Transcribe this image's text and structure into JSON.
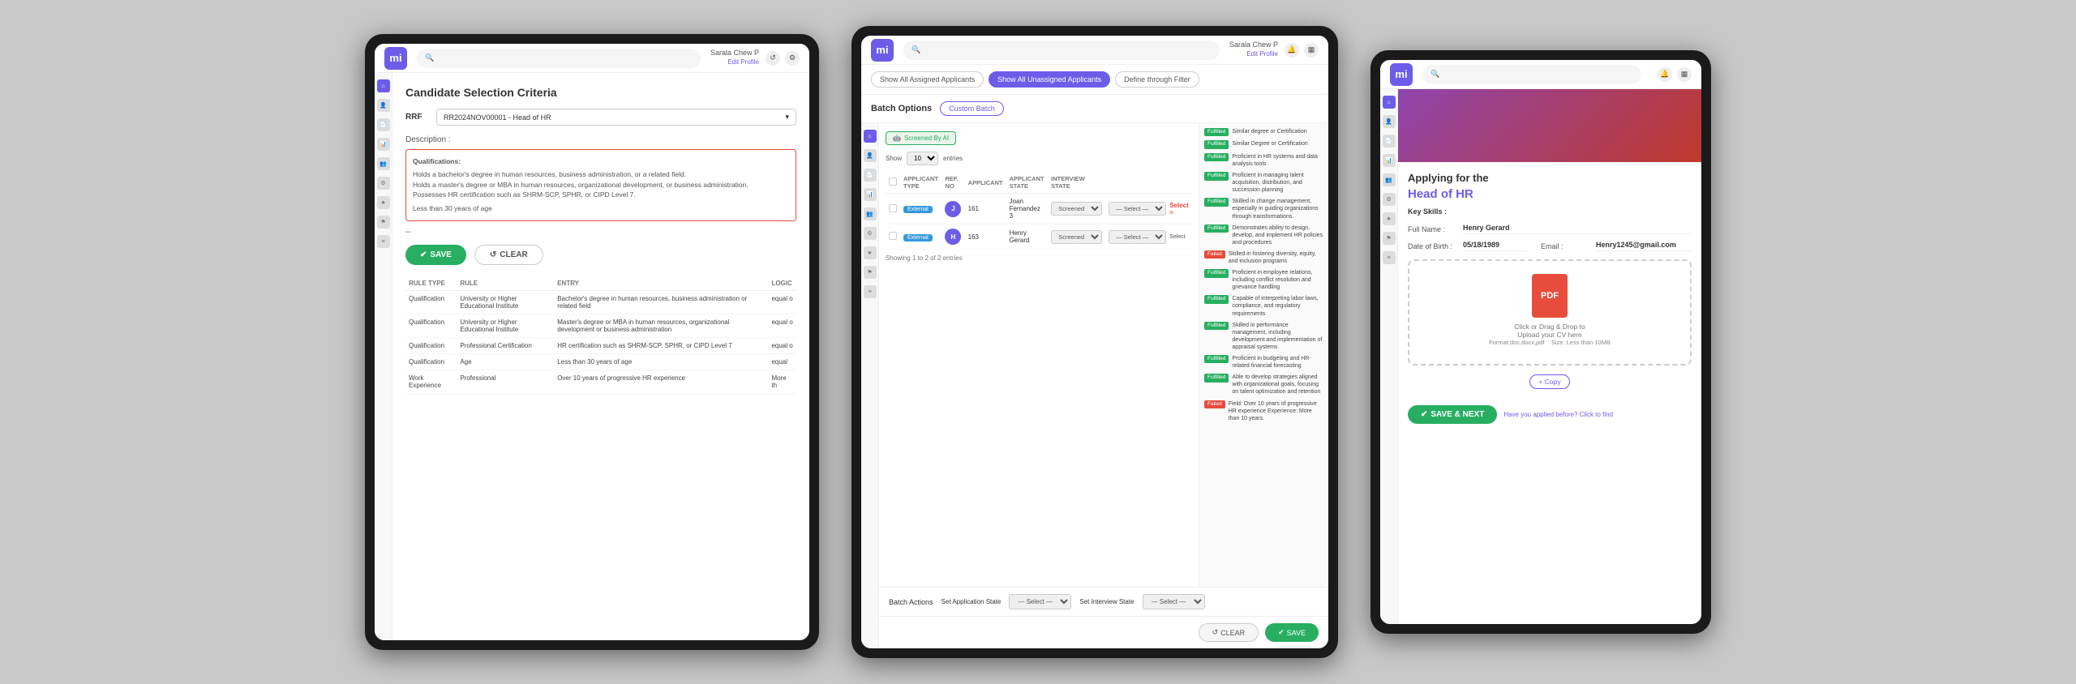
{
  "app": {
    "logo": "mi",
    "user": "Sarala Chew P",
    "user_role": "Edit Profile"
  },
  "tablet1": {
    "title": "Candidate Selection Criteria",
    "rrf_label": "RRF",
    "rrf_value": "RR2024NOV00001 - Head of HR",
    "description_label": "Description :",
    "description_text": "Qualifications:\nHolds a bachelor's degree in human resources, business administration, or a related field.\nHolds a master's degree or MBA in human resources, organizational development, or business administration.\nPossesses HR certification such as SHRM-SCP, SPHR, or CIPD Level 7.\n\nLess than 30 years of age",
    "dotdot": "--",
    "btn_save": "SAVE",
    "btn_clear": "CLEAR",
    "table_headers": [
      "RULE TYPE",
      "RULE",
      "ENTRY",
      "LOGIC"
    ],
    "table_rows": [
      {
        "rule_type": "Qualification",
        "rule": "University or Higher Educational Institute",
        "entry": "Bachelor's degree in human resources, business administration or related field",
        "logic": "equal o"
      },
      {
        "rule_type": "Qualification",
        "rule": "University or Higher Educational Institute",
        "entry": "Master's degree or MBA in human resources, organizational development or business administration",
        "logic": "equal o"
      },
      {
        "rule_type": "Qualification",
        "rule": "Professional Certification",
        "entry": "HR certification such as SHRM-SCP, SPHR, or CIPD Level 7",
        "logic": "equal o"
      },
      {
        "rule_type": "Qualification",
        "rule": "Age",
        "entry": "Less than 30 years of age",
        "logic": "equal"
      },
      {
        "rule_type": "Work Experience",
        "rule": "Professional",
        "entry": "Over 10 years of progressive HR experience",
        "logic": "More th"
      }
    ]
  },
  "tablet2": {
    "tabs": [
      {
        "label": "Show All Assigned Applicants",
        "active": false
      },
      {
        "label": "Show All Unassigned Applicants",
        "active": true
      },
      {
        "label": "Define through Filter",
        "active": false
      }
    ],
    "batch_options_label": "Batch Options",
    "custom_batch_btn": "Custom Batch",
    "ai_badge": "Screened By AI",
    "show_label": "Show",
    "show_value": "10",
    "entries_label": "entries",
    "table_headers": [
      "",
      "Applicant Type",
      "Ref. No",
      "Applicant",
      "Applicant State",
      "Interview State",
      ""
    ],
    "applicants": [
      {
        "type": "External",
        "ref_no": "161",
        "name": "Joan Fernandez 3",
        "app_state": "Screened",
        "int_state": "— Select —",
        "has_type": true
      },
      {
        "type": "External",
        "ref_no": "163",
        "name": "Henry Gerard",
        "app_state": "Screened",
        "int_state": "— Select —",
        "has_type": true
      }
    ],
    "showing_text": "Showing 1 to 2 of 2 entries",
    "batch_actions_label": "Batch Actions",
    "set_application_state": "Set Application State",
    "select_placeholder": "— Select —",
    "set_interview_state": "Set Interview State",
    "select_placeholder2": "— Select —",
    "btn_clear": "CLEAR",
    "btn_save": "SAVE",
    "select_label": "Select =",
    "select_sm": "Select",
    "criteria_items": [
      {
        "text": "Similar degree or Certification",
        "badge": "Fulfilled",
        "badge_type": "green"
      },
      {
        "text": "Similar Degree or Certification",
        "badge": "Fulfilled",
        "badge_type": "green"
      },
      {
        "text": "Proficient in HR systems and data analysis tools",
        "badge": "Fulfilled",
        "badge_type": "green"
      },
      {
        "text": "Proficient in managing talent acquisition, distribution, and succession planning",
        "badge": "Fulfilled",
        "badge_type": "green"
      },
      {
        "text": "Skilled in change management, especially in guiding organizations through transformations.",
        "badge": "Fulfilled",
        "badge_type": "green"
      },
      {
        "text": "Demonstrates ability to design, develop, and implement HR policies and procedures",
        "badge": "Fulfilled",
        "badge_type": "green"
      },
      {
        "text": "Skilled in fostering diversity, equity, and inclusion programs",
        "badge": "Failed",
        "badge_type": "orange"
      },
      {
        "text": "Proficient in employee relations, including conflict resolution and grievance handling",
        "badge": "Fulfilled",
        "badge_type": "green"
      },
      {
        "text": "Capable of interpreting labor laws, compliance, and regulatory requirements",
        "badge": "Fulfilled",
        "badge_type": "green"
      },
      {
        "text": "Skilled in performance management, including development and implementation of appraisal systems",
        "badge": "Fulfilled",
        "badge_type": "green"
      },
      {
        "text": "Proficient in budgeting and HR-related financial forecasting",
        "badge": "Fulfilled",
        "badge_type": "green"
      },
      {
        "text": "Able to develop strategies aligned with organizational goals, focusing on talent optimization and retention",
        "badge": "Fulfilled",
        "badge_type": "green"
      },
      {
        "text": "Field: Over 10 years of progressive HR experience Experience: More than 10 years.",
        "badge": "Failed",
        "badge_type": "orange"
      }
    ]
  },
  "tablet3": {
    "applying_for": "Applying for the",
    "role": "Head of HR",
    "key_skills_label": "Key Skills :",
    "full_name_label": "Full Name :",
    "full_name_value": "Henry Gerard",
    "dob_label": "Date of Birth :",
    "dob_value": "05/18/1989",
    "email_label": "Email :",
    "email_value": "Henry1245@gmail.com",
    "upload_text": "Click or Drag & Drop to\nUpload your CV here",
    "pdf_label": "PDF",
    "file_format": "Format:doc,docx,pdf",
    "file_size": "Size: Less than 10MB",
    "copy_btn": "+ Copy",
    "btn_save_next": "SAVE & NEXT",
    "applied_before": "Have you applied before? Click to find",
    "title_full": "Full Henry Gerard"
  }
}
